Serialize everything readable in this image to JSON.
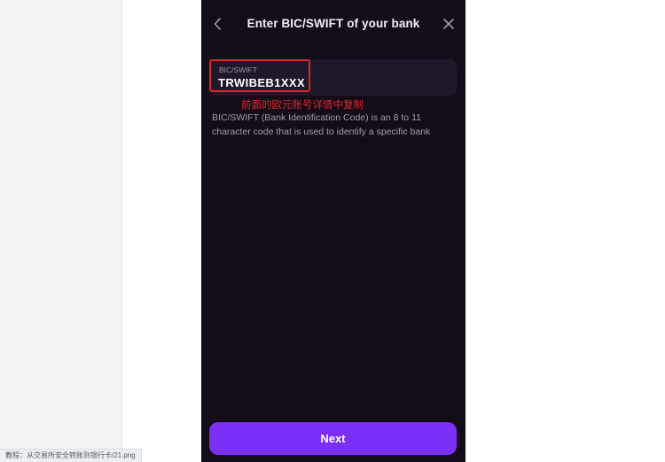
{
  "header": {
    "title": "Enter BIC/SWIFT of your bank",
    "back_icon": "chevron-left-icon",
    "close_icon": "close-icon"
  },
  "bic_field": {
    "label": "BIC/SWIFT",
    "value": "TRWIBEB1XXX"
  },
  "annotation": {
    "text": "前面的欧元账号详情中复制",
    "color": "#e0262b"
  },
  "help_text": "BIC/SWIFT (Bank Identification Code) is an 8 to 11 character code that is used to identify a specific bank",
  "next_button": {
    "label": "Next",
    "color": "#7b2ff7"
  },
  "status_bar": {
    "text": "教程：从交易所安全转账到银行卡/21.png"
  }
}
